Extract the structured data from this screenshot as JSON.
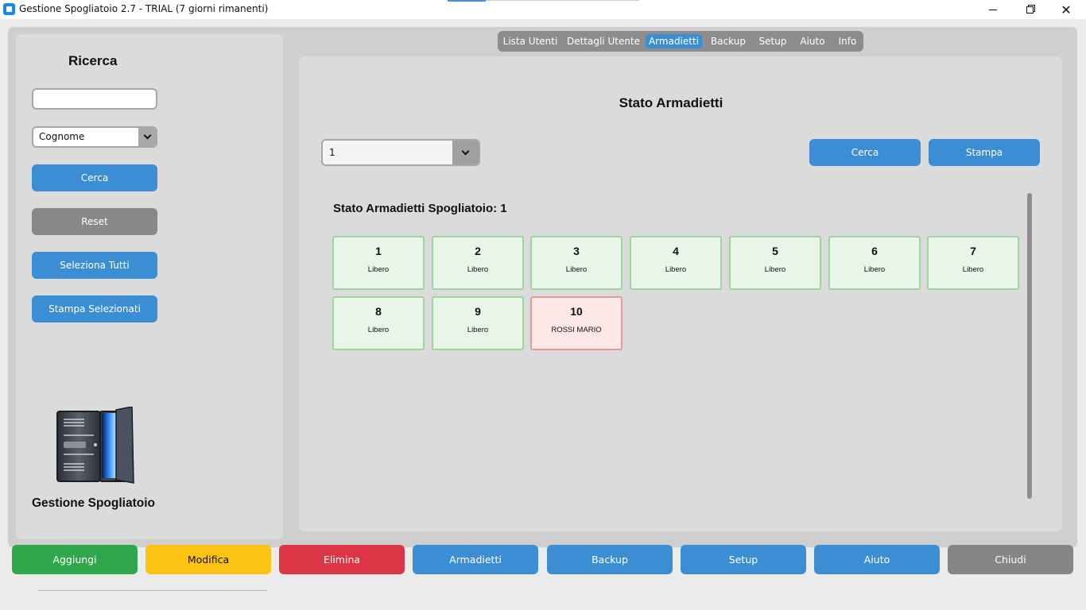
{
  "window": {
    "title": "Gestione Spogliatoio 2.7 - TRIAL (7 giorni rimanenti)",
    "controls": [
      "minimize-icon",
      "maximize-icon",
      "close-icon"
    ]
  },
  "sidebar": {
    "title": "Ricerca",
    "search_value": "",
    "search_field": "Cognome",
    "buttons": {
      "search": "Cerca",
      "reset": "Reset",
      "select_all": "Seleziona Tutti",
      "print_selected": "Stampa Selezionati"
    },
    "footer": "Gestione Spogliatoio"
  },
  "tabs": [
    {
      "label": "Lista Utenti",
      "active": false
    },
    {
      "label": "Dettagli Utente",
      "active": false
    },
    {
      "label": "Armadietti",
      "active": true
    },
    {
      "label": "Backup",
      "active": false
    },
    {
      "label": "Setup",
      "active": false
    },
    {
      "label": "Aiuto",
      "active": false
    },
    {
      "label": "Info",
      "active": false
    }
  ],
  "content": {
    "title": "Stato Armadietti",
    "room_select": "1",
    "search_button": "Cerca",
    "print_button": "Stampa",
    "grid_title": "Stato Armadietti Spogliatoio: 1",
    "lockers": [
      {
        "number": "1",
        "status": "Libero",
        "occupied": false
      },
      {
        "number": "2",
        "status": "Libero",
        "occupied": false
      },
      {
        "number": "3",
        "status": "Libero",
        "occupied": false
      },
      {
        "number": "4",
        "status": "Libero",
        "occupied": false
      },
      {
        "number": "5",
        "status": "Libero",
        "occupied": false
      },
      {
        "number": "6",
        "status": "Libero",
        "occupied": false
      },
      {
        "number": "7",
        "status": "Libero",
        "occupied": false
      },
      {
        "number": "8",
        "status": "Libero",
        "occupied": false
      },
      {
        "number": "9",
        "status": "Libero",
        "occupied": false
      },
      {
        "number": "10",
        "status": "ROSSI MARIO",
        "occupied": true
      }
    ]
  },
  "bottom_bar": {
    "add": "Aggiungi",
    "edit": "Modifica",
    "delete": "Elimina",
    "lockers": "Armadietti",
    "backup": "Backup",
    "setup": "Setup",
    "help": "Aiuto",
    "close": "Chiudi"
  },
  "colors": {
    "accent": "#3b8ed4",
    "free_bg": "#e8f5e8",
    "free_border": "#9bd69b",
    "occupied_bg": "#fde8e8",
    "occupied_border": "#e89a9a",
    "add": "#2ea84a",
    "edit": "#fcc214",
    "delete": "#dc3545",
    "close": "#868686"
  }
}
